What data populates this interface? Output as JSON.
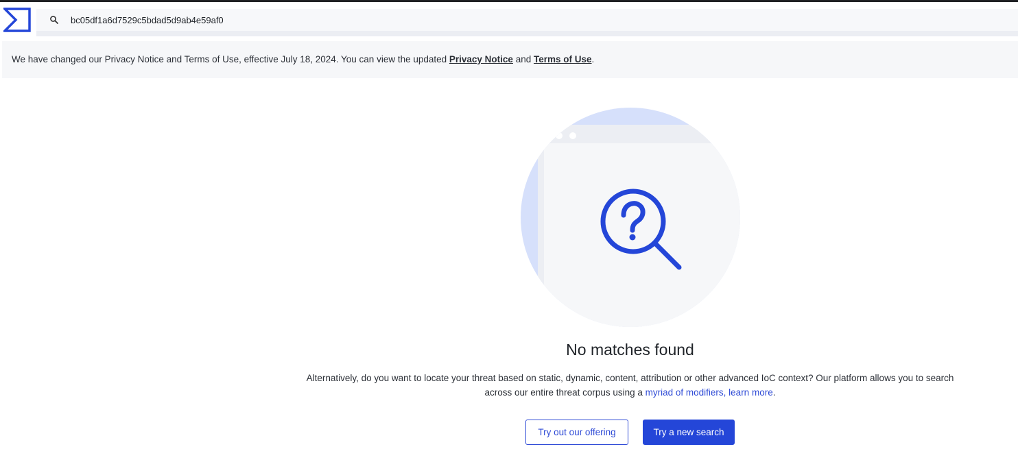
{
  "search": {
    "value": "bc05df1a6d7529c5bdad5d9ab4e59af0",
    "icon": "search-icon"
  },
  "notice": {
    "text_before": "We have changed our Privacy Notice and Terms of Use, effective July 18, 2024. You can view the updated ",
    "privacy_link": "Privacy Notice",
    "text_and": " and ",
    "terms_link": "Terms of Use",
    "text_end": "."
  },
  "empty_state": {
    "title": "No matches found",
    "description": "Alternatively, do you want to locate your threat based on static, dynamic, content, attribution or other advanced IoC context? Our platform allows you to search across our entire threat corpus using a ",
    "link_text": "myriad of modifiers, learn more",
    "description_end": "."
  },
  "buttons": {
    "offering": "Try out our offering",
    "new_search": "Try a new search"
  },
  "colors": {
    "accent": "#2446d8",
    "link": "#2f4bd6",
    "illustration_bg": "#d6e0fb"
  }
}
